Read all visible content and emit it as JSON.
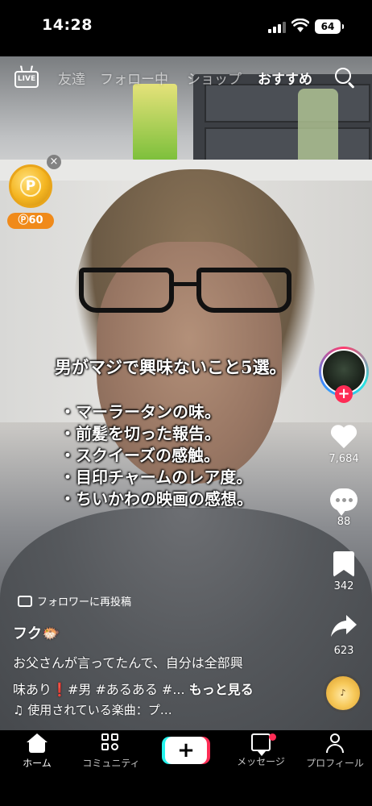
{
  "status_bar": {
    "time": "14:28",
    "battery": "64"
  },
  "top_nav": {
    "live_label": "LIVE",
    "tabs": [
      {
        "label": "友達",
        "active": false
      },
      {
        "label": "フォロー中",
        "active": false
      },
      {
        "label": "ショップ",
        "active": false
      },
      {
        "label": "おすすめ",
        "active": true
      }
    ]
  },
  "coin_widget": {
    "close": "×",
    "coin_symbol": "P",
    "badge": "Ⓟ60"
  },
  "overlay": {
    "title": "男がマジで興味ないこと5選。",
    "items": [
      "・マーラータンの味。",
      "・前髪を切った報告。",
      "・スクイーズの感触。",
      "・目印チャームのレア度。",
      "・ちいかわの映画の感想。"
    ]
  },
  "actions": {
    "follow_plus": "+",
    "likes": "7,684",
    "comments": "88",
    "bookmarks": "342",
    "shares": "623"
  },
  "caption": {
    "repost_label": "フォロワーに再投稿",
    "author": "フク🐡",
    "desc_line1": "お父さんが言ってたんで、自分は全部興",
    "desc_line2_prefix": "味あり",
    "desc_line2_mark": "❗",
    "desc_line2_tags": "#男 #あるある #...",
    "more": "もっと見る",
    "music": "♫ 使用されている楽曲：プ…"
  },
  "bottom_nav": {
    "home": "ホーム",
    "community": "コミュニティ",
    "create": "+",
    "messages": "メッセージ",
    "profile": "プロフィール"
  },
  "colors": {
    "accent_red": "#fe2c55",
    "accent_cyan": "#25f4ee",
    "coin_orange": "#f08a1a"
  }
}
